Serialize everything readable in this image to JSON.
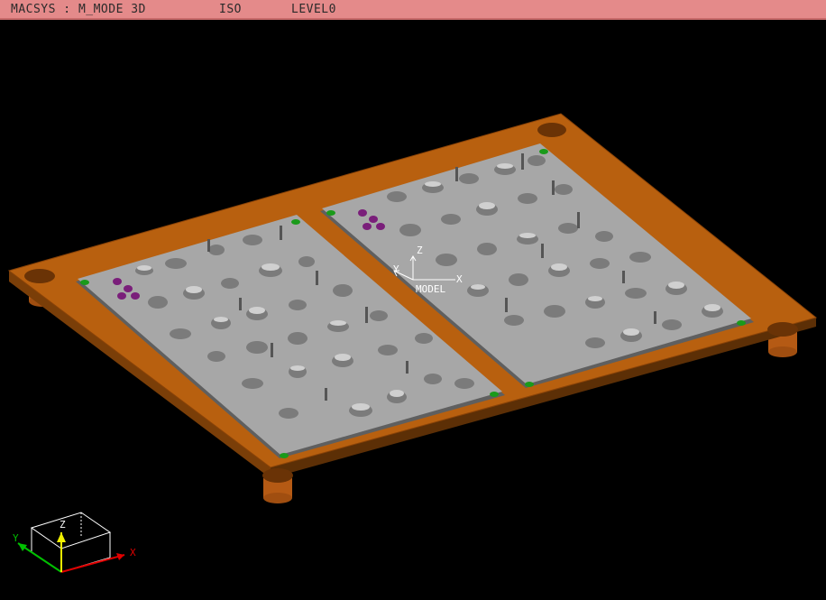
{
  "titlebar": {
    "system": "MACSYS : M_MODE 3D",
    "view": "ISO",
    "level": "LEVEL0"
  },
  "model_axis": {
    "x": "X",
    "y": "Y",
    "z": "Z",
    "label": "MODEL"
  },
  "view_cube": {
    "x": "X",
    "y": "Y",
    "z": "Z"
  },
  "colors": {
    "background": "#000000",
    "titlebar": "#e48a8a",
    "plate": "#b8600f",
    "insert": "#a7a7a7",
    "marker": "#1a9a1a",
    "highlight": "#7a1e7a"
  }
}
